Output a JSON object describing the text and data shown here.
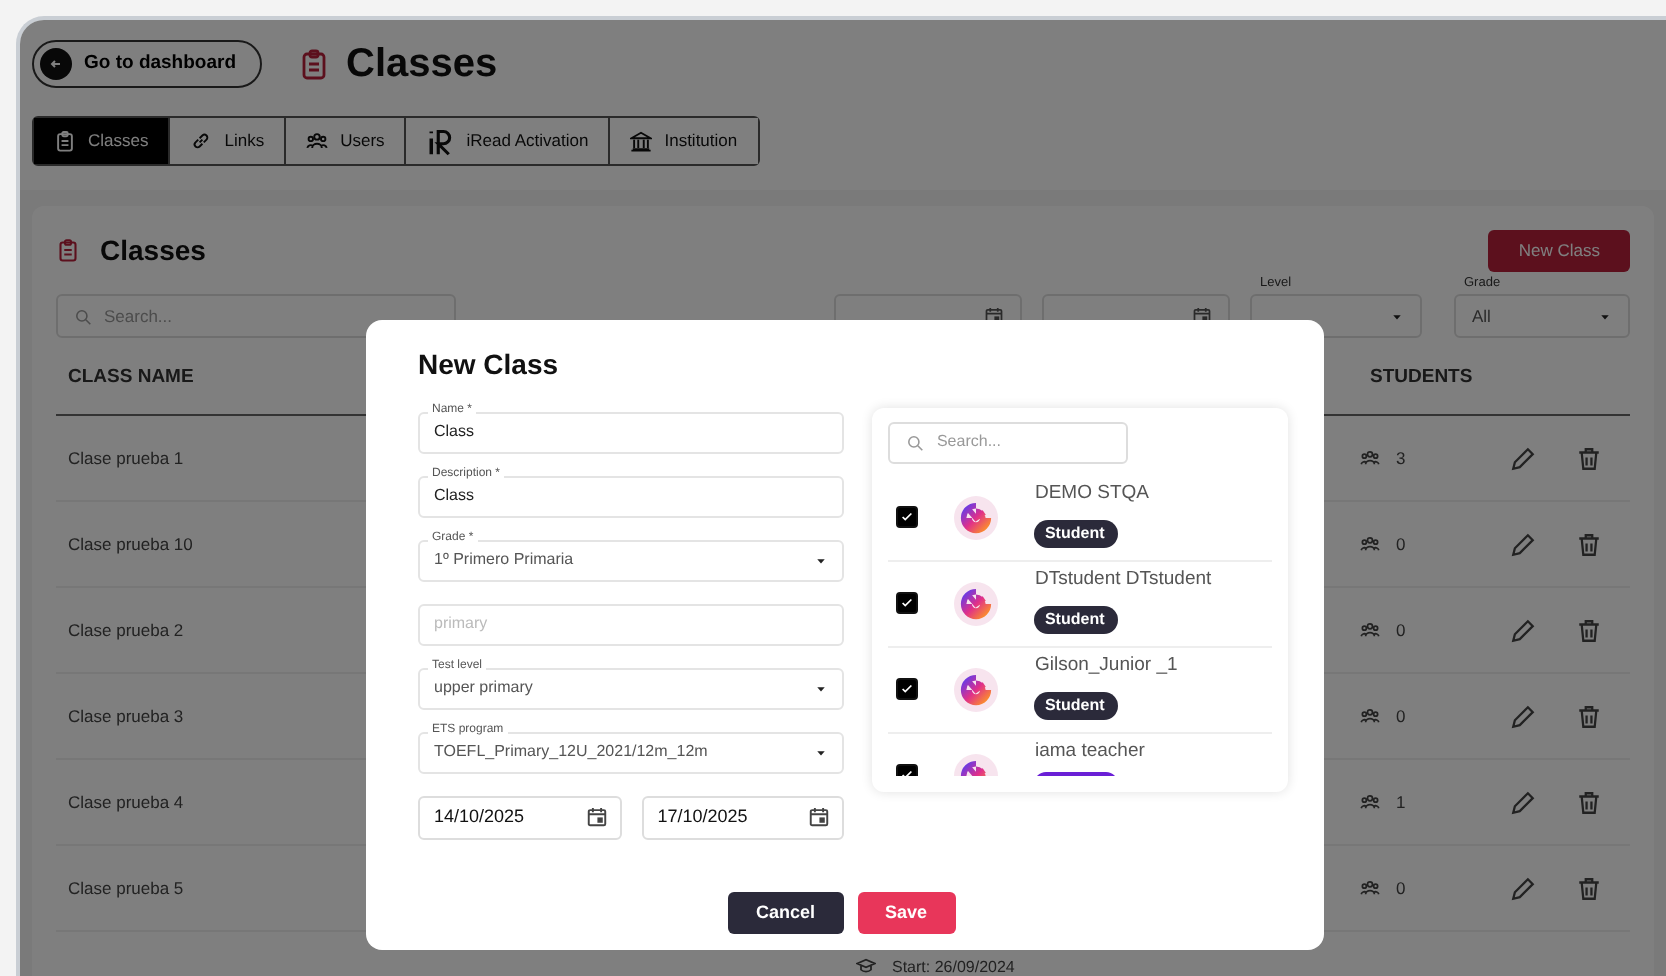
{
  "header": {
    "back_button": "Go to dashboard",
    "title": "Classes"
  },
  "tabs": [
    {
      "label": "Classes",
      "kind": "clipboard",
      "selected": true
    },
    {
      "label": "Links",
      "kind": "link",
      "selected": false
    },
    {
      "label": "Users",
      "kind": "users",
      "selected": false
    },
    {
      "label": "iRead Activation",
      "kind": "iread",
      "selected": false
    },
    {
      "label": "Institution",
      "kind": "building",
      "selected": false
    }
  ],
  "panel": {
    "title": "Classes",
    "new_button": "New Class",
    "search": {
      "placeholder": "Search..."
    },
    "level_filter": {
      "label": "Level"
    },
    "grade_filter": {
      "label": "Grade",
      "value": "All"
    },
    "columns": [
      "CLASS NAME",
      "STUDENTS"
    ],
    "rows": [
      {
        "name": "Clase prueba 1",
        "students": "3"
      },
      {
        "name": "Clase prueba 10",
        "students": "0"
      },
      {
        "name": "Clase prueba 2",
        "students": "0"
      },
      {
        "name": "Clase prueba 3",
        "students": "0"
      },
      {
        "name": "Clase prueba 4",
        "students": "1"
      },
      {
        "name": "Clase prueba 5",
        "students": "0"
      }
    ],
    "partial_row": {
      "start": "Start: 26/09/2024"
    }
  },
  "modal": {
    "title": "New Class",
    "fields": [
      {
        "kind": "text",
        "label": "Name *",
        "value": "Class"
      },
      {
        "kind": "text",
        "label": "Description *",
        "value": "Class"
      },
      {
        "kind": "select",
        "label": "Grade *",
        "value": "1º Primero Primaria"
      },
      {
        "kind": "text",
        "placeholder": "primary"
      },
      {
        "kind": "select",
        "label": "Test level",
        "value": "upper primary"
      },
      {
        "kind": "select",
        "label": "ETS program",
        "value": "TOEFL_Primary_12U_2021/12m_12m"
      }
    ],
    "dates": [
      "14/10/2025",
      "17/10/2025"
    ],
    "members": {
      "search": {
        "placeholder": "Search..."
      },
      "items": [
        {
          "name": "DEMO STQA",
          "role": "Student",
          "color": "#2b2a3a",
          "checked": true
        },
        {
          "name": "DTstudent DTstudent",
          "role": "Student",
          "color": "#2b2a3a",
          "checked": true
        },
        {
          "name": "Gilson_Junior _1",
          "role": "Student",
          "color": "#2b2a3a",
          "checked": true
        },
        {
          "name": "iama teacher",
          "color": "#6a1fd6",
          "checked": true
        }
      ]
    },
    "buttons": [
      {
        "label": "Cancel",
        "kind": "secondary"
      },
      {
        "label": "Save",
        "kind": "primary"
      }
    ]
  }
}
